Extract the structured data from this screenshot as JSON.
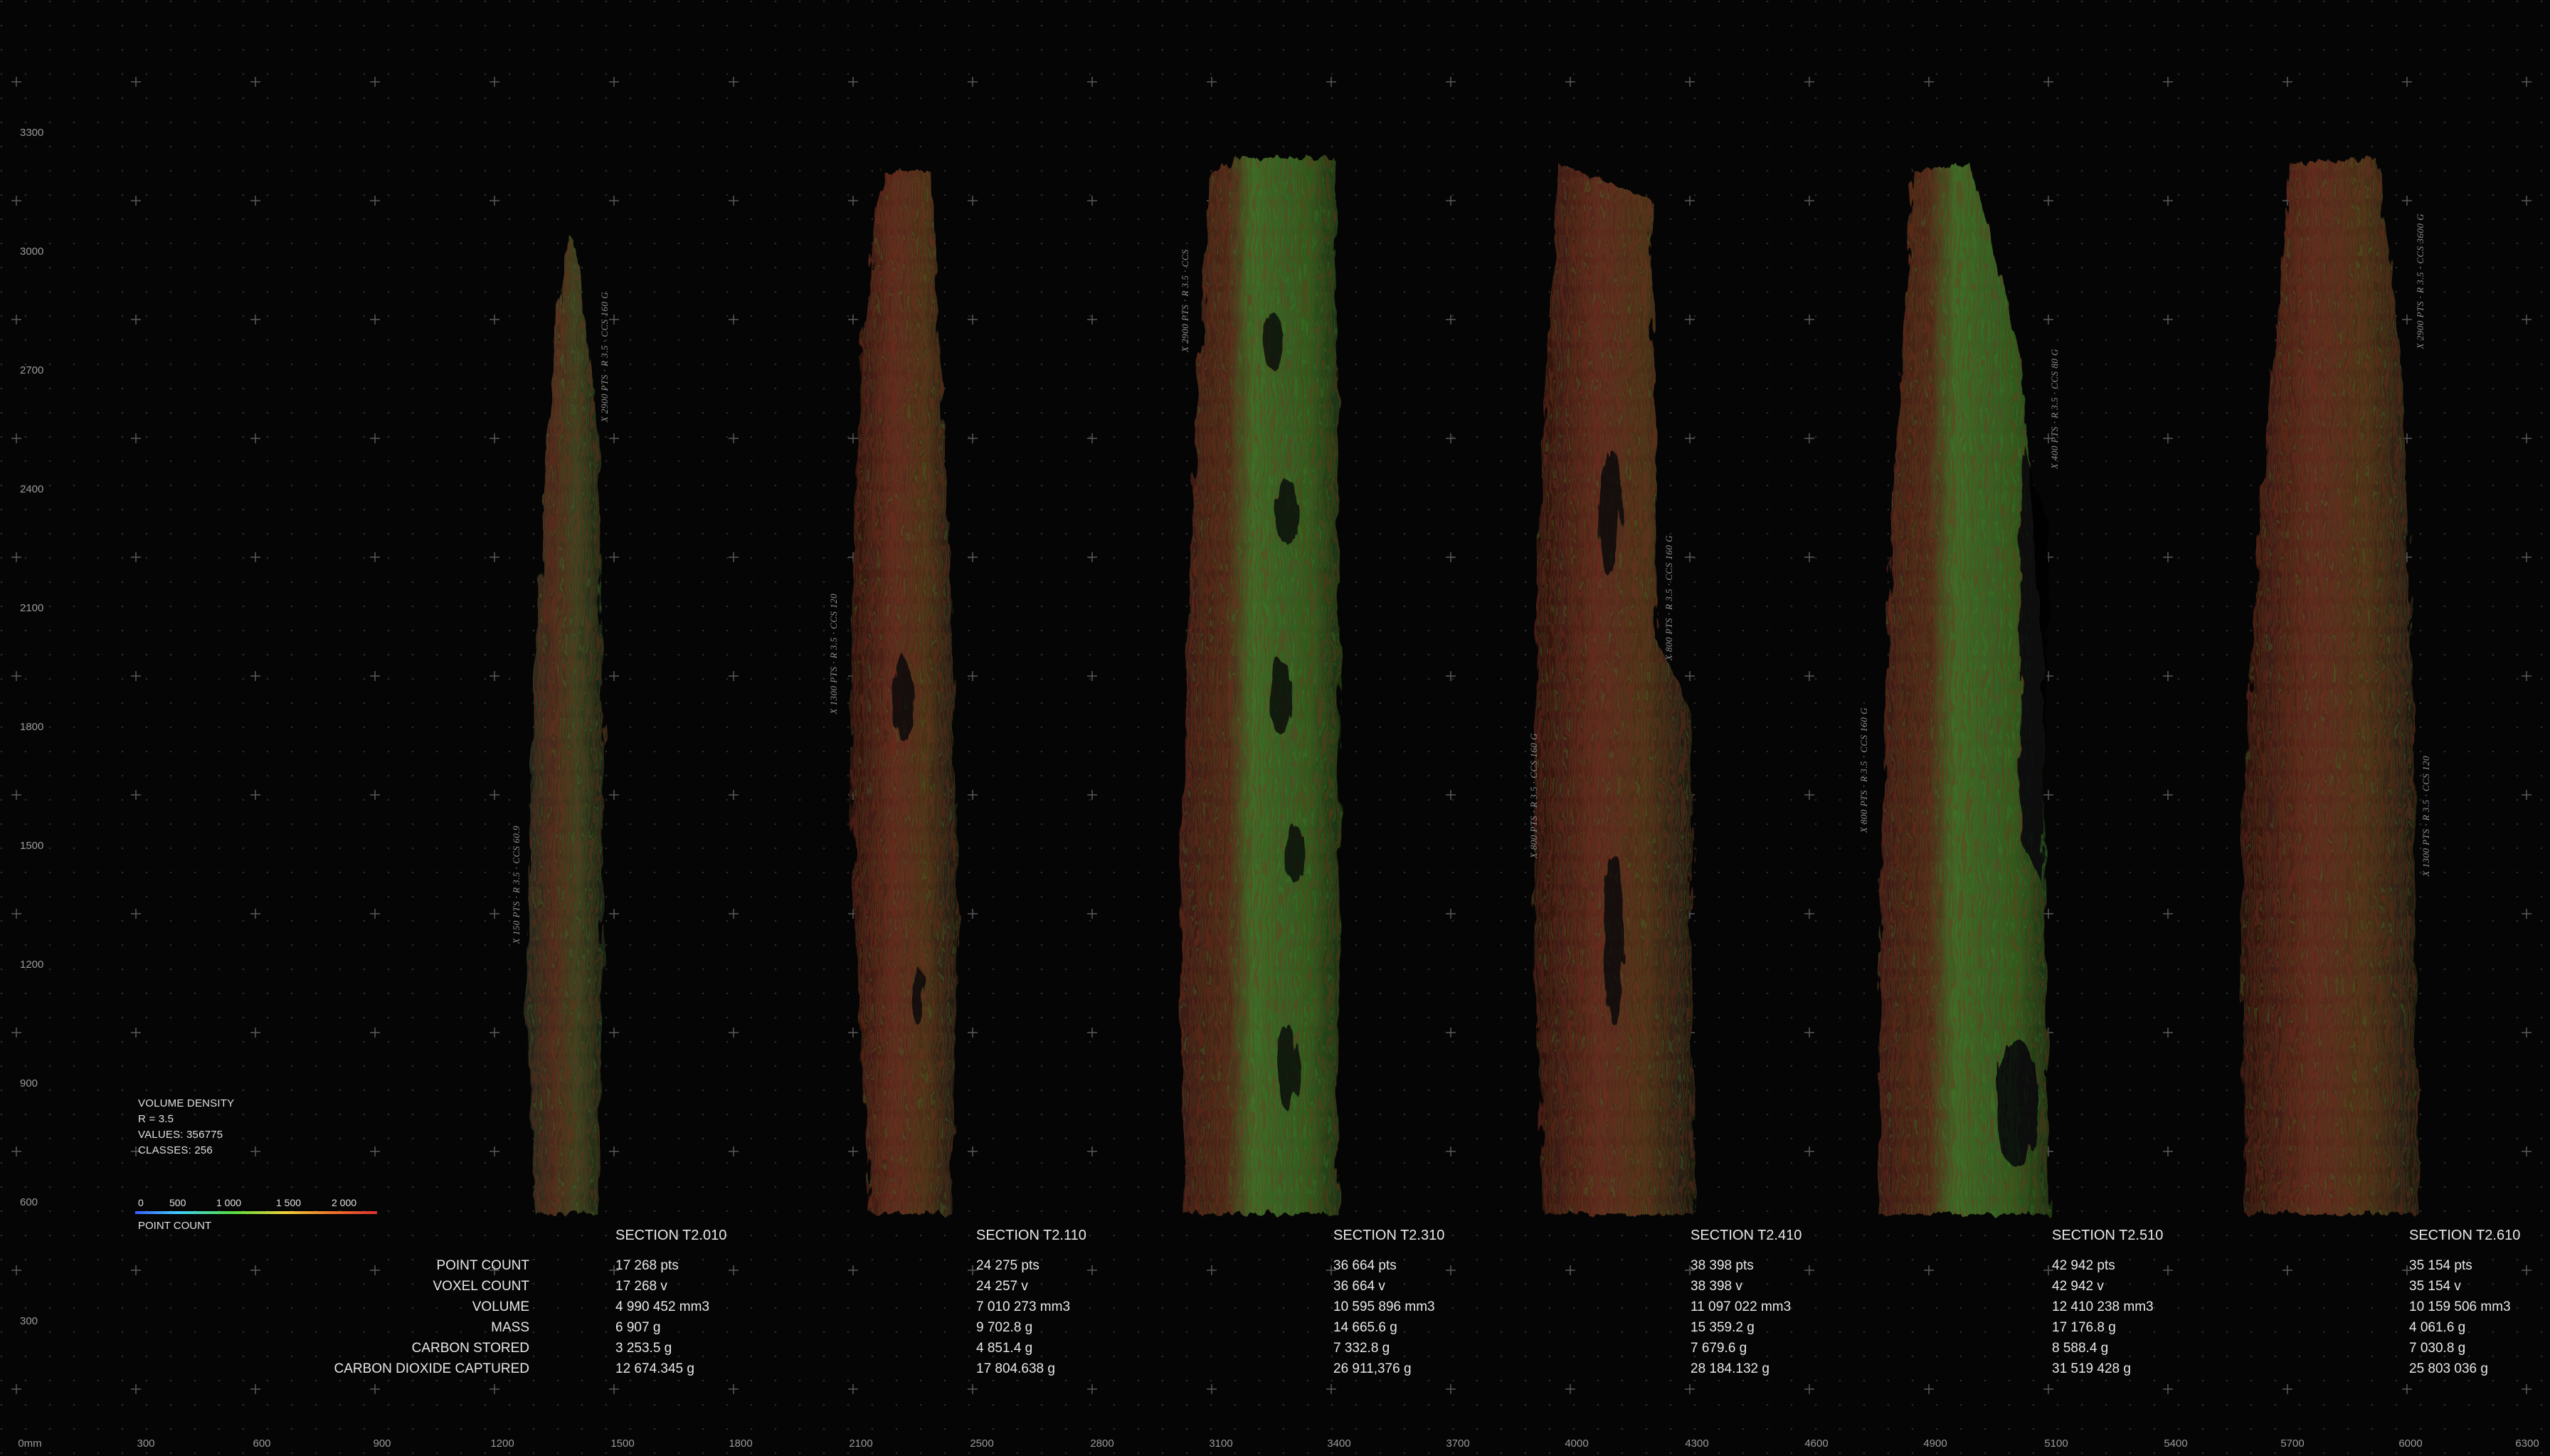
{
  "y_axis": [
    "3300",
    "3000",
    "2700",
    "2400",
    "2100",
    "1800",
    "1500",
    "1200",
    "900",
    "600",
    "300"
  ],
  "x_axis": [
    "0mm",
    "300",
    "600",
    "900",
    "1200",
    "1500",
    "1800",
    "2100",
    "2500",
    "2800",
    "3100",
    "3400",
    "3700",
    "4000",
    "4300",
    "4600",
    "4900",
    "5100",
    "5400",
    "5700",
    "6000",
    "6300"
  ],
  "legend": {
    "title": "VOLUME DENSITY",
    "r": "R = 3.5",
    "values": "VALUES: 356775",
    "classes": "CLASSES: 256",
    "ticks": [
      "0",
      "500",
      "1 000",
      "1 500",
      "2 000"
    ],
    "caption": "POINT COUNT",
    "colors": [
      "#3a60ff",
      "#3ed1ff",
      "#55e040",
      "#f2d23a",
      "#f07a2a",
      "#e03030"
    ]
  },
  "row_labels": [
    "POINT COUNT",
    "VOXEL COUNT",
    "VOLUME",
    "MASS",
    "CARBON STORED",
    "CARBON DIOXIDE CAPTURED"
  ],
  "sections": [
    {
      "title": "SECTION T2.010",
      "point_count": "17 268 pts",
      "voxel_count": "17 268 v",
      "volume": "4 990 452 mm3",
      "mass": "6 907 g",
      "carbon_stored": "3 253.5 g",
      "co2": "12 674.345 g",
      "vlabel": "X 150 PTS · R 3.5 · CCS 60.9"
    },
    {
      "title": "SECTION T2.110",
      "point_count": "24 275 pts",
      "voxel_count": "24 257 v",
      "volume": "7 010 273 mm3",
      "mass": "9 702.8 g",
      "carbon_stored": "4 851.4 g",
      "co2": "17 804.638 g",
      "vlabel": "X 1300 PTS · R 3.5 · CCS 120"
    },
    {
      "title": "SECTION T2.310",
      "point_count": "36 664 pts",
      "voxel_count": "36 664 v",
      "volume": "10 595 896 mm3",
      "mass": "14 665.6 g",
      "carbon_stored": "7 332.8 g",
      "co2": "26 911,376 g",
      "vlabel": "X 2900 PTS · R 3.5 · CCS"
    },
    {
      "title": "SECTION T2.410",
      "point_count": "38 398 pts",
      "voxel_count": "38 398 v",
      "volume": "11 097 022 mm3",
      "mass": "15 359.2 g",
      "carbon_stored": "7 679.6 g",
      "co2": "28 184.132 g",
      "vlabel": "X 800 PTS · R 3.5 · CCS 160 G"
    },
    {
      "title": "SECTION T2.510",
      "point_count": "42 942 pts",
      "voxel_count": "42 942 v",
      "volume": "12 410 238 mm3",
      "mass": "17 176.8 g",
      "carbon_stored": "8 588.4 g",
      "co2": "31 519 428 g",
      "vlabel": "X 800 PTS · R 3.5 · CCS 160 G"
    },
    {
      "title": "SECTION T2.610",
      "point_count": "35 154 pts",
      "voxel_count": "35 154 v",
      "volume": "10 159 506 mm3",
      "mass": "4 061.6 g",
      "carbon_stored": "7 030.8 g",
      "co2": "25 803 036 g",
      "vlabel": "X 1300 PTS · R 3.5 · CCS 120"
    }
  ],
  "extra_vlabels": [
    "X 2900 PTS · R 3.5 · CCS 160 G",
    "X 800 PTS · R 3.5 · CCS 160 G",
    "X 400 PTS · R 3.5 · CCS 80 G",
    "X 2900 PTS · R 3.5 · CCS 3600 G"
  ]
}
